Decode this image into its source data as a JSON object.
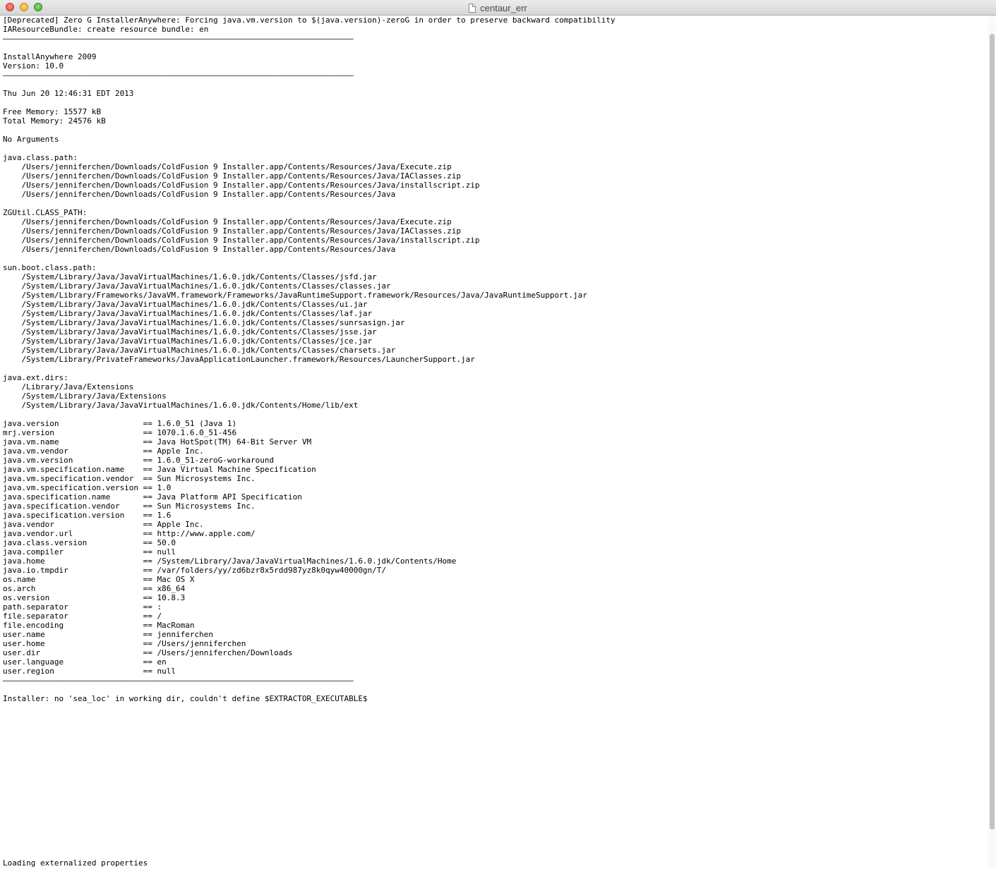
{
  "window": {
    "title": "centaur_err"
  },
  "log": {
    "lines": [
      "[Deprecated] Zero G InstallerAnywhere: Forcing java.vm.version to $(java.version)-zeroG in order to preserve backward compatibility",
      "IAResourceBundle: create resource bundle: en",
      "———————————————————————————————————————————————————————————————————————————",
      "",
      "InstallAnywhere 2009",
      "Version: 10.0",
      "———————————————————————————————————————————————————————————————————————————",
      "",
      "Thu Jun 20 12:46:31 EDT 2013",
      "",
      "Free Memory: 15577 kB",
      "Total Memory: 24576 kB",
      "",
      "No Arguments",
      "",
      "java.class.path:",
      "    /Users/jenniferchen/Downloads/ColdFusion 9 Installer.app/Contents/Resources/Java/Execute.zip",
      "    /Users/jenniferchen/Downloads/ColdFusion 9 Installer.app/Contents/Resources/Java/IAClasses.zip",
      "    /Users/jenniferchen/Downloads/ColdFusion 9 Installer.app/Contents/Resources/Java/installscript.zip",
      "    /Users/jenniferchen/Downloads/ColdFusion 9 Installer.app/Contents/Resources/Java",
      "",
      "ZGUtil.CLASS_PATH:",
      "    /Users/jenniferchen/Downloads/ColdFusion 9 Installer.app/Contents/Resources/Java/Execute.zip",
      "    /Users/jenniferchen/Downloads/ColdFusion 9 Installer.app/Contents/Resources/Java/IAClasses.zip",
      "    /Users/jenniferchen/Downloads/ColdFusion 9 Installer.app/Contents/Resources/Java/installscript.zip",
      "    /Users/jenniferchen/Downloads/ColdFusion 9 Installer.app/Contents/Resources/Java",
      "",
      "sun.boot.class.path:",
      "    /System/Library/Java/JavaVirtualMachines/1.6.0.jdk/Contents/Classes/jsfd.jar",
      "    /System/Library/Java/JavaVirtualMachines/1.6.0.jdk/Contents/Classes/classes.jar",
      "    /System/Library/Frameworks/JavaVM.framework/Frameworks/JavaRuntimeSupport.framework/Resources/Java/JavaRuntimeSupport.jar",
      "    /System/Library/Java/JavaVirtualMachines/1.6.0.jdk/Contents/Classes/ui.jar",
      "    /System/Library/Java/JavaVirtualMachines/1.6.0.jdk/Contents/Classes/laf.jar",
      "    /System/Library/Java/JavaVirtualMachines/1.6.0.jdk/Contents/Classes/sunrsasign.jar",
      "    /System/Library/Java/JavaVirtualMachines/1.6.0.jdk/Contents/Classes/jsse.jar",
      "    /System/Library/Java/JavaVirtualMachines/1.6.0.jdk/Contents/Classes/jce.jar",
      "    /System/Library/Java/JavaVirtualMachines/1.6.0.jdk/Contents/Classes/charsets.jar",
      "    /System/Library/PrivateFrameworks/JavaApplicationLauncher.framework/Resources/LauncherSupport.jar",
      "",
      "java.ext.dirs:",
      "    /Library/Java/Extensions",
      "    /System/Library/Java/Extensions",
      "    /System/Library/Java/JavaVirtualMachines/1.6.0.jdk/Contents/Home/lib/ext",
      "",
      "java.version                  == 1.6.0_51 (Java 1)",
      "mrj.version                   == 1070.1.6.0_51-456",
      "java.vm.name                  == Java HotSpot(TM) 64-Bit Server VM",
      "java.vm.vendor                == Apple Inc.",
      "java.vm.version               == 1.6.0_51-zeroG-workaround",
      "java.vm.specification.name    == Java Virtual Machine Specification",
      "java.vm.specification.vendor  == Sun Microsystems Inc.",
      "java.vm.specification.version == 1.0",
      "java.specification.name       == Java Platform API Specification",
      "java.specification.vendor     == Sun Microsystems Inc.",
      "java.specification.version    == 1.6",
      "java.vendor                   == Apple Inc.",
      "java.vendor.url               == http://www.apple.com/",
      "java.class.version            == 50.0",
      "java.compiler                 == null",
      "java.home                     == /System/Library/Java/JavaVirtualMachines/1.6.0.jdk/Contents/Home",
      "java.io.tmpdir                == /var/folders/yy/zd6bzr8x5rdd987yz8k0qyw40000gn/T/",
      "os.name                       == Mac OS X",
      "os.arch                       == x86_64",
      "os.version                    == 10.8.3",
      "path.separator                == :",
      "file.separator                == /",
      "file.encoding                 == MacRoman",
      "user.name                     == jenniferchen",
      "user.home                     == /Users/jenniferchen",
      "user.dir                      == /Users/jenniferchen/Downloads",
      "user.language                 == en",
      "user.region                   == null",
      "———————————————————————————————————————————————————————————————————————————",
      "",
      "Installer: no 'sea_loc' in working dir, couldn't define $EXTRACTOR_EXECUTABLE$"
    ]
  },
  "status": {
    "text": "Loading externalized properties"
  }
}
